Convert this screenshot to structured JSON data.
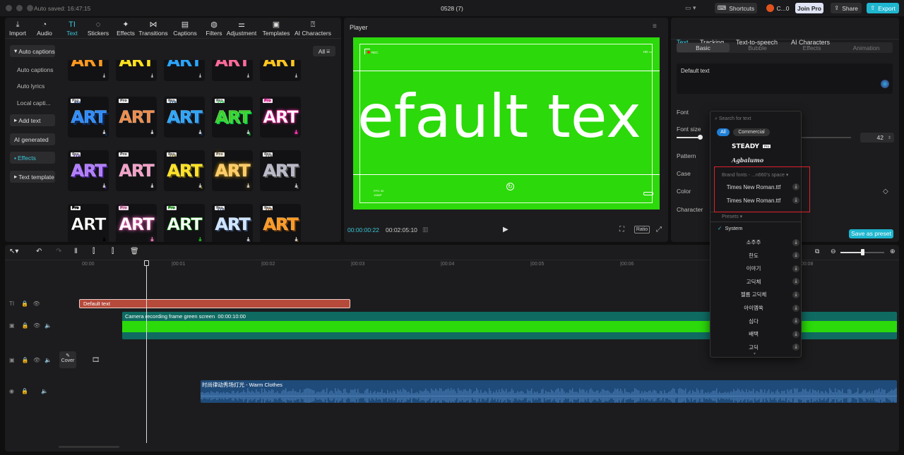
{
  "titlebar": {
    "autosave": "Auto saved: 16:47:15",
    "project": "0528 (7)",
    "shortcuts": "Shortcuts",
    "user": "C...0",
    "join_pro": "Join Pro",
    "share": "Share",
    "export": "Export"
  },
  "toolbar": [
    {
      "label": "Import",
      "icon": "import-icon"
    },
    {
      "label": "Audio",
      "icon": "audio-icon"
    },
    {
      "label": "Text",
      "icon": "text-icon"
    },
    {
      "label": "Stickers",
      "icon": "sticker-icon"
    },
    {
      "label": "Effects",
      "icon": "effects-icon"
    },
    {
      "label": "Transitions",
      "icon": "transition-icon"
    },
    {
      "label": "Captions",
      "icon": "captions-icon"
    },
    {
      "label": "Filters",
      "icon": "filters-icon"
    },
    {
      "label": "Adjustment",
      "icon": "adjust-icon"
    },
    {
      "label": "Templates",
      "icon": "templates-icon"
    },
    {
      "label": "AI Characters",
      "icon": "ai-characters-icon"
    }
  ],
  "sidebar": {
    "auto_captions_group": "Auto captions",
    "items": [
      "Auto captions",
      "Auto lyrics",
      "Local capti..."
    ],
    "add_text": "Add text",
    "ai_generated": "AI generated",
    "effects": "Effects",
    "text_template": "Text template"
  },
  "filter": {
    "all": "All"
  },
  "art_grid": {
    "label": "ART",
    "pro": "Pro"
  },
  "player": {
    "title": "Player",
    "overlay_text": "efault tex",
    "rec": "REC",
    "hd": "HD",
    "fps": "FPS: 30",
    "res": "1080P",
    "current_time": "00:00:00:22",
    "total_time": "00:02:05:10",
    "ratio": "Ratio"
  },
  "props": {
    "tabs": [
      "Text",
      "Tracking",
      "Text-to-speech",
      "AI Characters"
    ],
    "subtabs": [
      "Basic",
      "Bubble",
      "Effects",
      "Animation"
    ],
    "textarea": "Default text",
    "font_label": "Font",
    "font_size_label": "Font size",
    "font_size_value": "42",
    "pattern_label": "Pattern",
    "case_label": "Case",
    "color_label": "Color",
    "character_label": "Character",
    "save_preset": "Save as preset"
  },
  "font_dropdown": {
    "search_placeholder": "Search for text",
    "filter_all": "All",
    "filter_commercial": "Commercial",
    "featured": [
      "STEADY",
      "Agbalumo"
    ],
    "featured_badge": "Pro",
    "brand_section": "Brand fonts - ...n660's space",
    "brand_fonts": [
      "Times New Roman.ttf",
      "Times New Roman.ttf"
    ],
    "presets_section": "Presets",
    "system": "System",
    "fonts": [
      "소주주",
      "한도",
      "이야기",
      "고딕체",
      "젤름 고딕체",
      "아이엠쑥",
      "심다",
      "배택",
      "고딕"
    ]
  },
  "timeline": {
    "ruler": [
      "00:00",
      "|00:01",
      "|00:02",
      "|00:03",
      "|00:04",
      "|00:05",
      "|00:06",
      "|00:07",
      "|00:08"
    ],
    "text_clip": "Default text",
    "video_clip": "Camera recording frame green screen",
    "video_clip_duration": "00:00:10:00",
    "cover": "Cover",
    "audio_clip": "时尚律动秀场灯光 - Warm Clothes"
  },
  "colors": {
    "accent": "#39c6d6",
    "green": "#2cd90a",
    "text_clip": "#b5493a",
    "video_clip": "#0f6b62",
    "audio_clip": "#1f4b7a",
    "highlight": "#e0212a"
  }
}
